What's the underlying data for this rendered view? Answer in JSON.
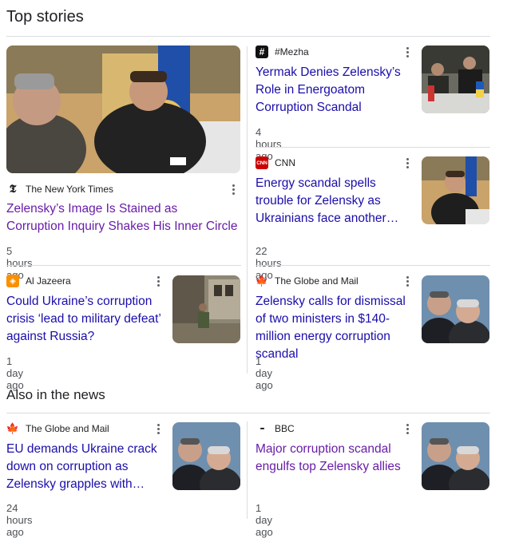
{
  "top_stories": {
    "title": "Top stories",
    "cards": [
      {
        "source": "The New York Times",
        "headline": "Zelensky’s Image Is Stained as Corruption Inquiry Shakes His Inner Circle",
        "time": "5 hours ago"
      },
      {
        "source": "#Mezha",
        "headline": "Yermak Denies Zelensky’s Role in Energoatom Corruption Scandal",
        "time": "4 hours ago"
      },
      {
        "source": "CNN",
        "headline": "Energy scandal spells trouble for Zelensky as Ukrainians face another winter of powe…",
        "time": "22 hours ago"
      },
      {
        "source": "Al Jazeera",
        "headline": "Could Ukraine’s corruption crisis ‘lead to military defeat’ against Russia?",
        "time": "1 day ago"
      },
      {
        "source": "The Globe and Mail",
        "headline": "Zelensky calls for dismissal of two ministers in $140-million energy corruption scandal",
        "time": "1 day ago"
      }
    ]
  },
  "also_in_news": {
    "title": "Also in the news",
    "cards": [
      {
        "source": "The Globe and Mail",
        "headline": "EU demands Ukraine crack down on corruption as Zelensky grapples with…",
        "time": "24 hours ago"
      },
      {
        "source": "BBC",
        "headline": "Major corruption scandal engulfs top Zelensky allies",
        "time": "1 day ago"
      }
    ]
  },
  "logos": {
    "nyt": "𝕿",
    "mezha": "#",
    "cnn": "CNN",
    "aljazeera": "◈",
    "globe": "🍁",
    "bbc": "▪▪▪"
  },
  "colors": {
    "link": "#1a0dab",
    "visited": "#681da8",
    "meta": "#4d5156",
    "divider": "#dadce0"
  }
}
